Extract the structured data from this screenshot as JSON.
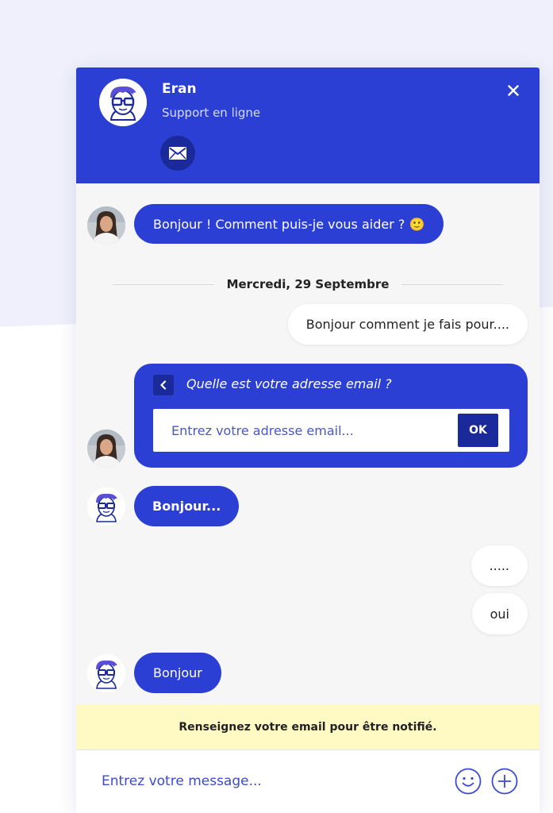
{
  "colors": {
    "brand": "#2b3fd4",
    "brand_dark": "#1a2a9a",
    "notice_bg": "#fff9c4"
  },
  "header": {
    "agent_name": "Eran",
    "agent_role": "Support en ligne",
    "icons": [
      "agent-avatar-icon",
      "mail-icon",
      "close-icon"
    ]
  },
  "messages": {
    "m1": "Bonjour ! Comment puis-je vous aider ? 🙂",
    "date_separator": "Mercredi, 29 Septembre",
    "m2": "Bonjour comment je fais pour....",
    "m3": "Bonjour...",
    "m4": ".....",
    "m5": "oui",
    "m6": "Bonjour"
  },
  "email_form": {
    "question": "Quelle est votre adresse email ?",
    "placeholder": "Entrez votre adresse email...",
    "ok_label": "OK"
  },
  "notice": {
    "text": "Renseignez votre email pour être notifié."
  },
  "composer": {
    "placeholder": "Entrez votre message...",
    "icons": [
      "emoji-icon",
      "plus-icon"
    ]
  }
}
